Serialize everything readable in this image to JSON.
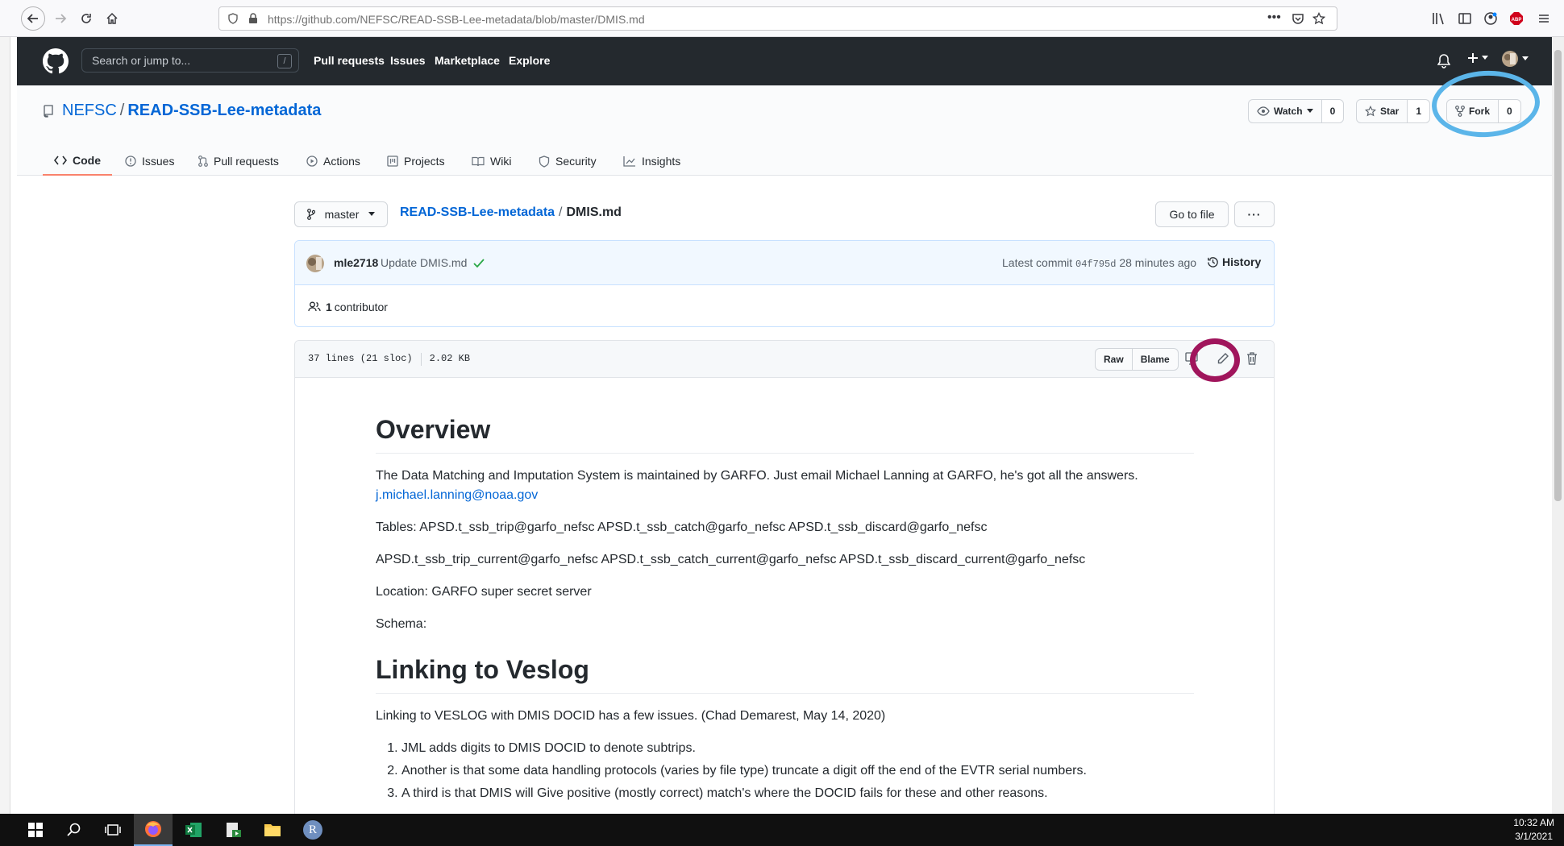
{
  "browser": {
    "url": "https://github.com/NEFSC/READ-SSB-Lee-metadata/blob/master/DMIS.md"
  },
  "github": {
    "search_placeholder": "Search or jump to...",
    "search_key": "/",
    "nav": [
      "Pull requests",
      "Issues",
      "Marketplace",
      "Explore"
    ]
  },
  "repo": {
    "owner": "NEFSC",
    "name": "READ-SSB-Lee-metadata",
    "watch_label": "Watch",
    "watch_count": "0",
    "star_label": "Star",
    "star_count": "1",
    "fork_label": "Fork",
    "fork_count": "0",
    "tabs": [
      "Code",
      "Issues",
      "Pull requests",
      "Actions",
      "Projects",
      "Wiki",
      "Security",
      "Insights"
    ]
  },
  "file_nav": {
    "branch": "master",
    "repo_link": "READ-SSB-Lee-metadata",
    "file_name": "DMIS.md",
    "go_to_file": "Go to file",
    "more": "···"
  },
  "commit": {
    "author": "mle2718",
    "message": "Update DMIS.md",
    "latest_label": "Latest commit",
    "sha": "04f795d",
    "time": "28 minutes ago",
    "history": "History",
    "contributors_count": "1",
    "contributors_label": "contributor"
  },
  "file": {
    "lines": "37 lines (21 sloc)",
    "size": "2.02 KB",
    "raw": "Raw",
    "blame": "Blame"
  },
  "markdown": {
    "h1_overview": "Overview",
    "p1": "The Data Matching and Imputation System is maintained by GARFO. Just email Michael Lanning at GARFO, he's got all the answers.",
    "p1_link": "j.michael.lanning@noaa.gov",
    "p2": "Tables: APSD.t_ssb_trip@garfo_nefsc APSD.t_ssb_catch@garfo_nefsc APSD.t_ssb_discard@garfo_nefsc",
    "p3": "APSD.t_ssb_trip_current@garfo_nefsc APSD.t_ssb_catch_current@garfo_nefsc APSD.t_ssb_discard_current@garfo_nefsc",
    "p4": "Location: GARFO super secret server",
    "p5": "Schema:",
    "h1_linking": "Linking to Veslog",
    "p6": "Linking to VESLOG with DMIS DOCID has a few issues. (Chad Demarest, May 14, 2020)",
    "list": [
      "JML adds digits to DMIS DOCID to denote subtrips.",
      "Another is that some data handling protocols (varies by file type) truncate a digit off the end of the EVTR serial numbers.",
      "A third is that DMIS will Give positive (mostly correct) match's where the DOCID fails for these and other reasons."
    ]
  },
  "taskbar": {
    "time": "10:32 AM",
    "date": "3/1/2021",
    "r_label": "R"
  },
  "colors": {
    "annotation_blue": "#5bb5e9",
    "annotation_magenta": "#a0155c",
    "link": "#0366d6"
  }
}
